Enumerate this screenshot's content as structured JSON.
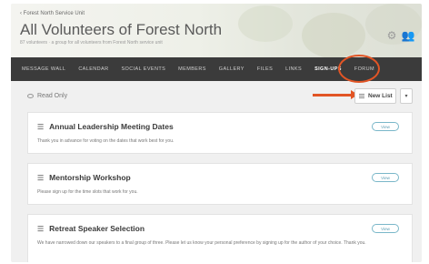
{
  "group": {
    "breadcrumb": "‹ Forest North Service Unit",
    "title": "All Volunteers of Forest North",
    "subline": "87 volunteers · a group for all volunteers from Forest North service unit"
  },
  "nav": {
    "items": [
      {
        "label": "MESSAGE WALL",
        "active": false
      },
      {
        "label": "CALENDAR",
        "active": false
      },
      {
        "label": "SOCIAL EVENTS",
        "active": false
      },
      {
        "label": "MEMBERS",
        "active": false
      },
      {
        "label": "GALLERY",
        "active": false
      },
      {
        "label": "FILES",
        "active": false
      },
      {
        "label": "LINKS",
        "active": false
      },
      {
        "label": "SIGN-UPS",
        "active": true
      },
      {
        "label": "FORUM",
        "active": false
      }
    ]
  },
  "toolbar": {
    "read_only_label": "Read Only",
    "new_list_label": "New List",
    "dropdown_glyph": "▾"
  },
  "lists": [
    {
      "title": "Annual Leadership Meeting Dates",
      "description": "Thank you in advance for voting on the dates that work best for you.",
      "view_label": "View"
    },
    {
      "title": "Mentorship Workshop",
      "description": "Please sign up for the time slots that work for you.",
      "view_label": "View"
    },
    {
      "title": "Retreat Speaker Selection",
      "description": "We have narrowed down our speakers to a final group of three. Please let us know your personal preference by signing up for the author of your choice. Thank you.",
      "view_label": "View"
    }
  ],
  "colors": {
    "accent": "#e25525",
    "nav_bg": "#3b3b3b",
    "link": "#5a9db2"
  }
}
